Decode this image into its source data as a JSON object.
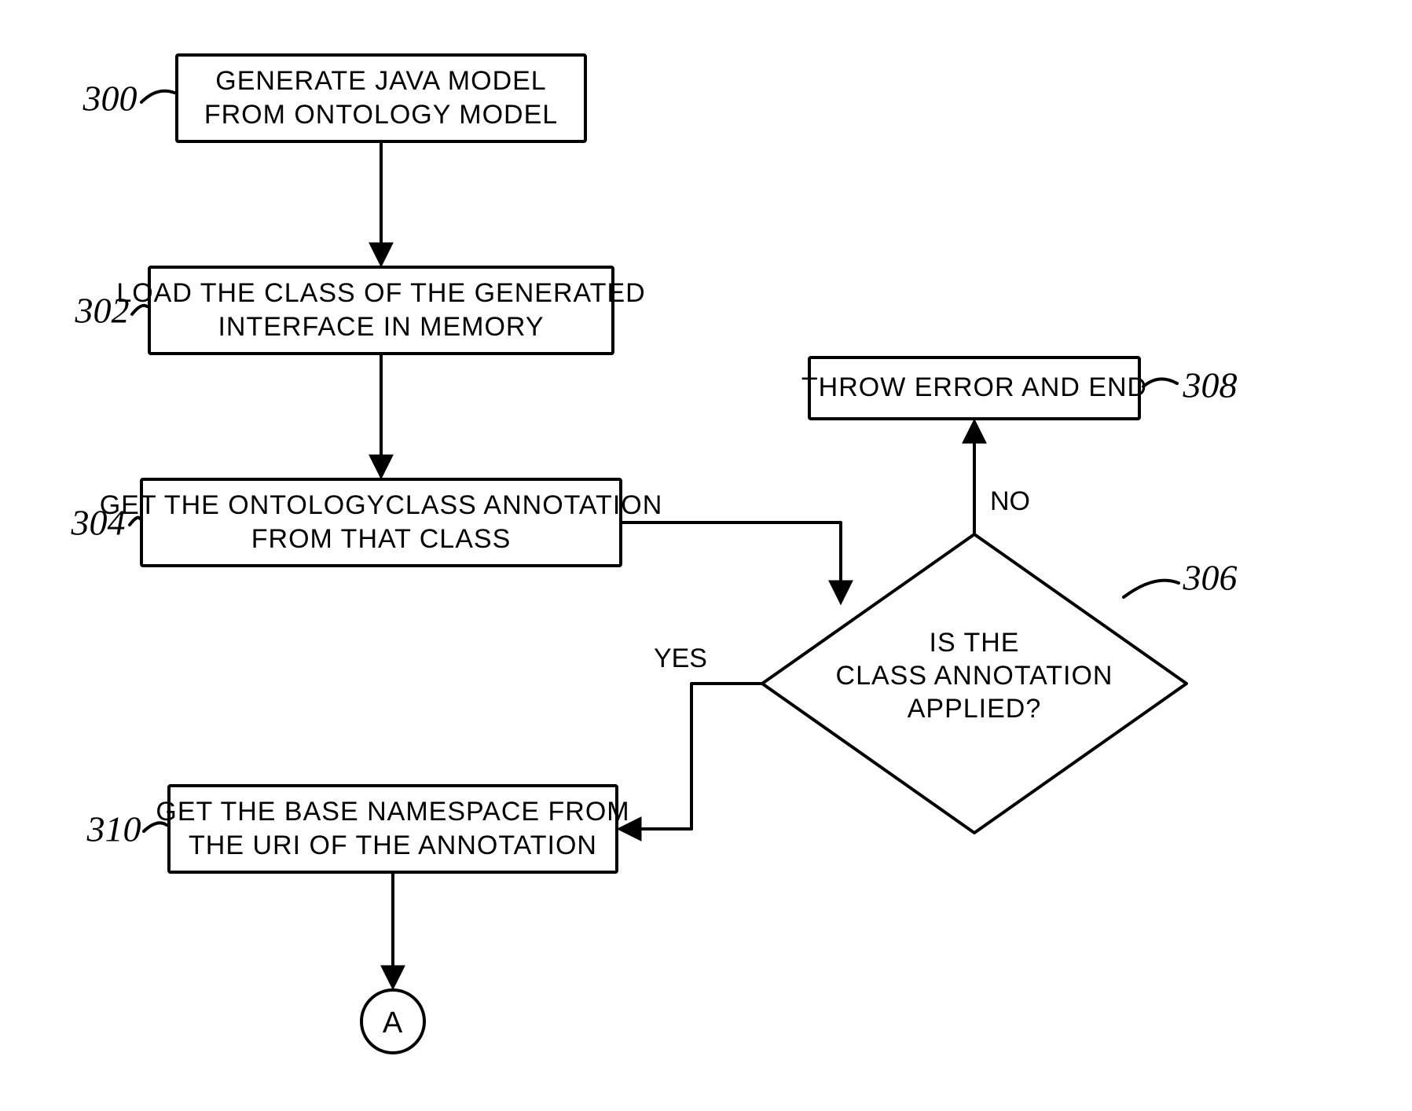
{
  "nodes": {
    "n300": {
      "ref": "300",
      "lines": [
        "GENERATE JAVA MODEL",
        "FROM ONTOLOGY MODEL"
      ]
    },
    "n302": {
      "ref": "302",
      "lines": [
        "LOAD THE CLASS OF THE GENERATED",
        "INTERFACE IN MEMORY"
      ]
    },
    "n304": {
      "ref": "304",
      "lines": [
        "GET THE ONTOLOGYCLASS ANNOTATION",
        "FROM THAT CLASS"
      ]
    },
    "n306": {
      "ref": "306",
      "lines": [
        "IS THE",
        "CLASS ANNOTATION",
        "APPLIED?"
      ]
    },
    "n308": {
      "ref": "308",
      "lines": [
        "THROW ERROR AND END"
      ]
    },
    "n310": {
      "ref": "310",
      "lines": [
        "GET THE BASE NAMESPACE FROM",
        "THE URI OF THE ANNOTATION"
      ]
    }
  },
  "connector": {
    "label": "A"
  },
  "branches": {
    "yes": "YES",
    "no": "NO"
  }
}
